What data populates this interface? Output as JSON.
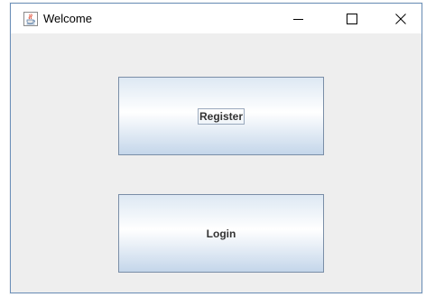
{
  "window": {
    "title": "Welcome",
    "app_icon": "java-cup-icon",
    "controls": {
      "minimize_icon": "minimize-icon",
      "maximize_icon": "maximize-icon",
      "close_icon": "close-icon"
    }
  },
  "buttons": {
    "register_label": "Register",
    "login_label": "Login"
  },
  "colors": {
    "window_border": "#6b8fb8",
    "content_bg": "#eeeeee",
    "button_border": "#7a8ea7",
    "button_gradient_top": "#dde8f3",
    "button_gradient_bottom": "#c4d6ea",
    "label_text": "#333333"
  }
}
